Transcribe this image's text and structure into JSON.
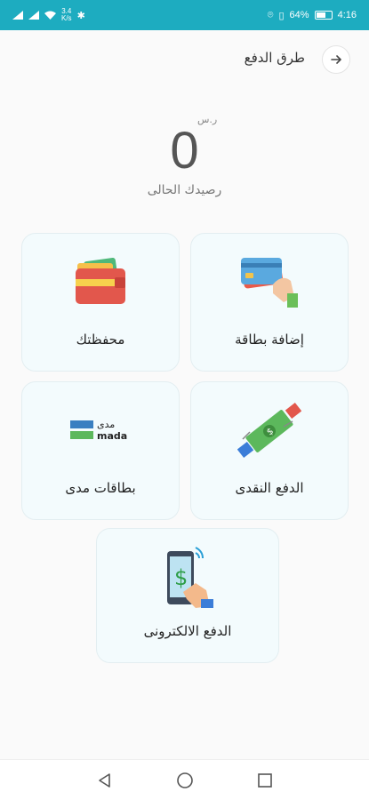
{
  "status_bar": {
    "net_speed_top": "3.4",
    "net_speed_unit": "K/s",
    "battery": "64%",
    "time": "4:16"
  },
  "header": {
    "title": "طرق الدفع",
    "back_icon": "arrow-right-icon"
  },
  "balance": {
    "currency": "ر.س",
    "amount": "0",
    "label": "رصيدك الحالى"
  },
  "options": [
    {
      "label": "إضافة بطاقة",
      "icon": "card-in-hand-icon"
    },
    {
      "label": "محفظتك",
      "icon": "wallet-icon"
    },
    {
      "label": "الدفع النقدى",
      "icon": "cash-exchange-icon"
    },
    {
      "label": "بطاقات مدى",
      "icon": "mada-logo-icon",
      "logo_text_ar": "مدى",
      "logo_text_en": "mada"
    },
    {
      "label": "الدفع الالكترونى",
      "icon": "phone-payment-icon"
    }
  ],
  "nav": {
    "back_icon": "triangle-back-icon",
    "home_icon": "circle-home-icon",
    "recents_icon": "square-recents-icon"
  }
}
